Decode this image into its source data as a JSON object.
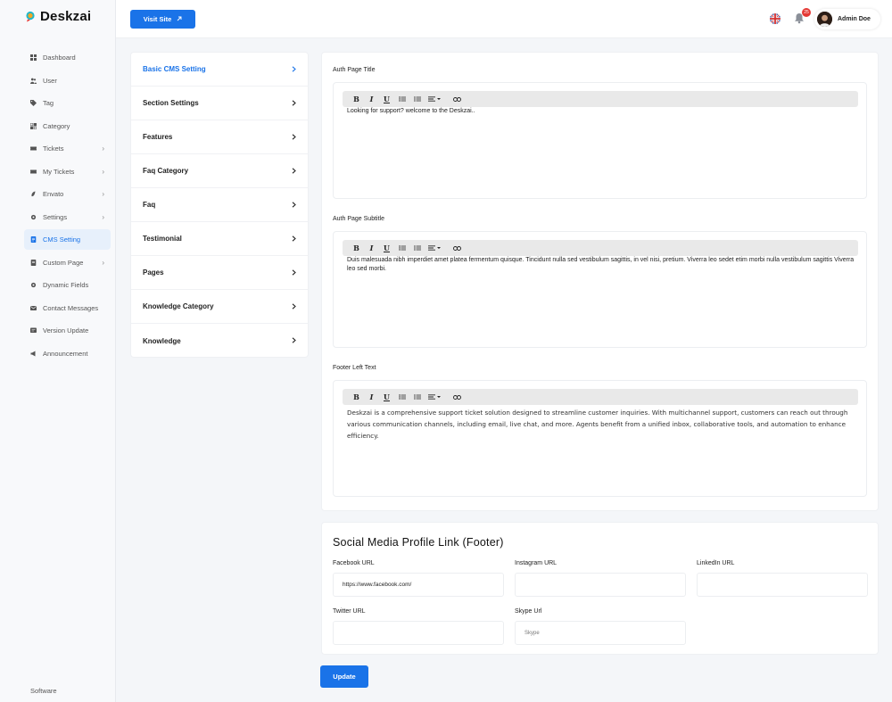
{
  "brand": {
    "name": "Deskzai",
    "accent": "#1a73e8"
  },
  "sidebar": {
    "items": [
      {
        "label": "Dashboard",
        "icon": "grid-icon",
        "chevron": false
      },
      {
        "label": "User",
        "icon": "users-icon",
        "chevron": false
      },
      {
        "label": "Tag",
        "icon": "tag-icon",
        "chevron": false
      },
      {
        "label": "Category",
        "icon": "category-icon",
        "chevron": false
      },
      {
        "label": "Tickets",
        "icon": "ticket-icon",
        "chevron": true
      },
      {
        "label": "My Tickets",
        "icon": "ticket-icon",
        "chevron": true
      },
      {
        "label": "Envato",
        "icon": "envato-icon",
        "chevron": true
      },
      {
        "label": "Settings",
        "icon": "gear-icon",
        "chevron": true
      },
      {
        "label": "CMS Setting",
        "icon": "document-icon",
        "chevron": false,
        "active": true
      },
      {
        "label": "Custom Page",
        "icon": "page-icon",
        "chevron": true
      },
      {
        "label": "Dynamic Fields",
        "icon": "gear-icon",
        "chevron": false
      },
      {
        "label": "Contact Messages",
        "icon": "message-icon",
        "chevron": false
      },
      {
        "label": "Version Update",
        "icon": "update-icon",
        "chevron": false
      },
      {
        "label": "Announcement",
        "icon": "megaphone-icon",
        "chevron": false
      }
    ],
    "footer": "Software"
  },
  "header": {
    "visit_site": "Visit Site",
    "notification_count": "25",
    "user_name": "Admin Doe"
  },
  "settings_menu": {
    "items": [
      {
        "label": "Basic CMS Setting",
        "active": true
      },
      {
        "label": "Section Settings"
      },
      {
        "label": "Features"
      },
      {
        "label": "Faq Category"
      },
      {
        "label": "Faq"
      },
      {
        "label": "Testimonial"
      },
      {
        "label": "Pages"
      },
      {
        "label": "Knowledge Category"
      },
      {
        "label": "Knowledge"
      }
    ]
  },
  "editors": {
    "auth_title": {
      "label": "Auth Page Title",
      "content": "Looking for support? welcome to the Deskzai.."
    },
    "auth_subtitle": {
      "label": "Auth Page Subtitle",
      "content": "Duis malesuada nibh imperdiet amet platea fermentum quisque. Tincidunt nulla sed vestibulum sagittis, in vel nisi, pretium. Viverra leo sedet etim morbi nulla vestibulum sagittis Viverra leo sed morbi."
    },
    "footer_left": {
      "label": "Footer Left Text",
      "content": "Deskzai is a comprehensive support ticket solution designed to streamline customer inquiries. With multichannel support, customers can reach out through various communication channels, including email, live chat, and more. Agents benefit from a unified inbox, collaborative tools, and automation to enhance efficiency."
    }
  },
  "social": {
    "title": "Social Media Profile Link (Footer)",
    "facebook": {
      "label": "Facebook URL",
      "value": "https://www.facebook.com/"
    },
    "instagram": {
      "label": "Instagram URL",
      "value": ""
    },
    "linkedin": {
      "label": "LinkedIn URL",
      "value": ""
    },
    "twitter": {
      "label": "Twitter URL",
      "value": ""
    },
    "skype": {
      "label": "Skype Url",
      "placeholder": "Skype"
    }
  },
  "update_button": "Update"
}
